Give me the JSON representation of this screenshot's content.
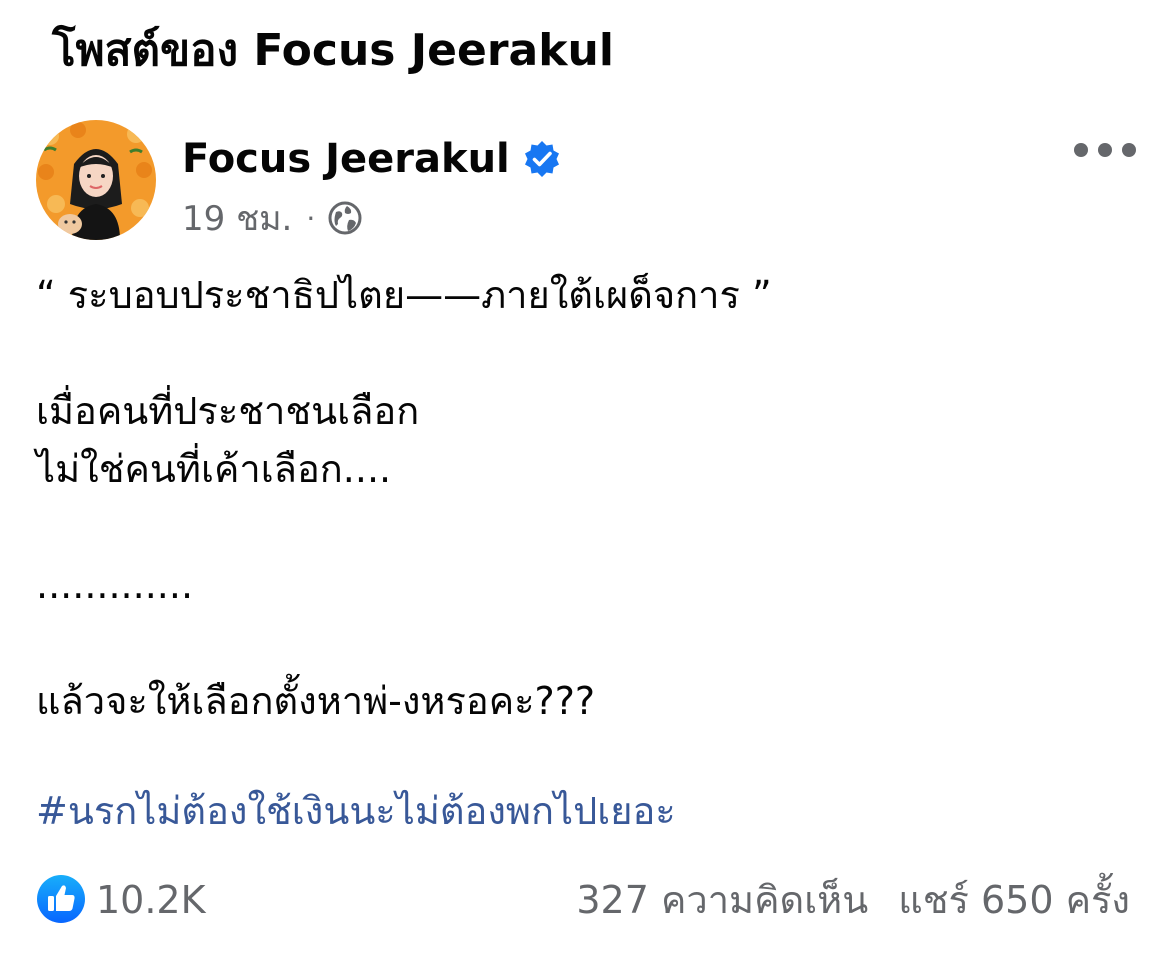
{
  "header": {
    "title": "โพสต์ของ Focus Jeerakul"
  },
  "post": {
    "author": "Focus Jeerakul",
    "verified_icon": "verified-badge-icon",
    "timestamp": "19 ชม.",
    "separator": "·",
    "privacy_icon": "globe-icon",
    "more_icon": "more-horizontal-icon",
    "lines": [
      "“ ระบอบประชาธิปไตย——ภายใต้เผด็จการ ”",
      "",
      "เมื่อคนที่ประชาชนเลือก",
      "ไม่ใช่คนที่เค้าเลือก....",
      "",
      ".............",
      "",
      "แล้วจะให้เลือกตั้งหาพ่-งหรอคะ???"
    ],
    "hashtag": "#นรกไม่ต้องใช้เงินนะไม่ต้องพกไปเยอะ"
  },
  "stats": {
    "reaction_icon": "like-icon",
    "likes": "10.2K",
    "comments": "327 ความคิดเห็น",
    "shares": "แชร์ 650 ครั้ง"
  },
  "colors": {
    "text": "#050505",
    "secondary": "#65676b",
    "link": "#385898",
    "facebook_blue": "#1877f2",
    "avatar_bg": "#f39a2b"
  }
}
